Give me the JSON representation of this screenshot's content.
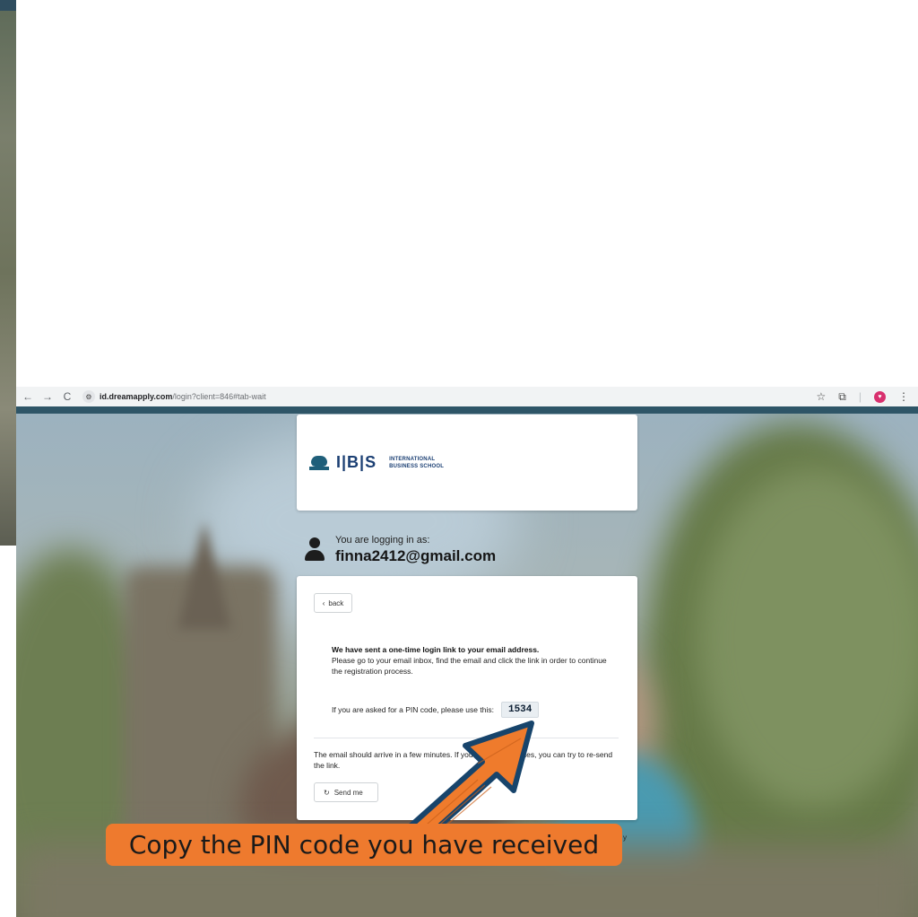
{
  "browser": {
    "url_host": "id.dreamapply.com",
    "url_path": "/login?client=846#tab-wait",
    "nav": {
      "back": "←",
      "forward": "→",
      "reload": "C"
    },
    "icons": [
      "star-icon",
      "extensions-icon",
      "profile-icon",
      "menu-icon"
    ]
  },
  "logo": {
    "mark": "I|B|S",
    "subtitle_line1": "INTERNATIONAL",
    "subtitle_line2": "BUSINESS SCHOOL"
  },
  "login": {
    "label": "You are logging in as:",
    "email": "finna2412@gmail.com"
  },
  "card": {
    "back_label": "back",
    "heading": "We have sent a one-time login link to your email address.",
    "body": "Please go to your email inbox, find the email and click the link in order to continue the registration process.",
    "pin_label": "If you are asked for a PIN code, please use this:",
    "pin_code": "1534",
    "resend_text": "The email should arrive in a few minutes. If you are having issues, you can try to re-send the link.",
    "resend_button": "Send me"
  },
  "caption": {
    "text": "Copy the PIN code you have received",
    "partial_right": "y"
  },
  "colors": {
    "caption_bg": "#ee7a2e",
    "arrow_fill": "#ef7b2c",
    "arrow_outline": "#17446b",
    "brand_dark": "#1b3f73",
    "brand_light": "#2aa3d6"
  }
}
